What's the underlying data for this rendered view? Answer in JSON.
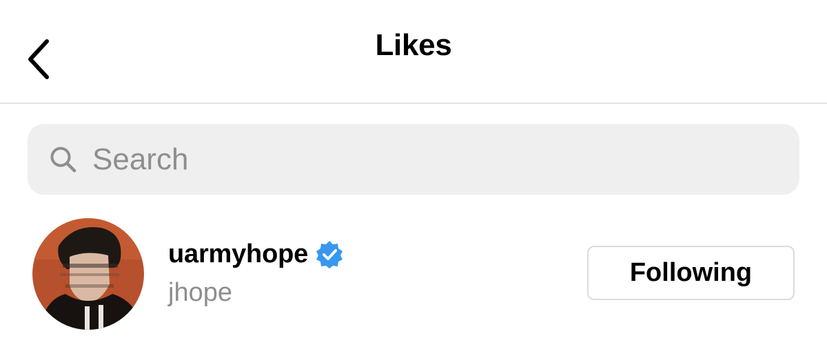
{
  "header": {
    "title": "Likes",
    "back_icon": "chevron-left-icon"
  },
  "search": {
    "placeholder": "Search",
    "value": "",
    "icon": "search-icon"
  },
  "users": [
    {
      "username": "uarmyhope",
      "full_name": "jhope",
      "verified": true,
      "verified_icon": "verified-badge-icon",
      "follow_status": "Following"
    }
  ],
  "colors": {
    "background": "#ffffff",
    "text_primary": "#000000",
    "text_secondary": "#8e8e8e",
    "search_background": "#efefef",
    "verified_blue": "#3897f0",
    "button_border": "#dbdbdb",
    "divider": "#e3e3e3"
  }
}
